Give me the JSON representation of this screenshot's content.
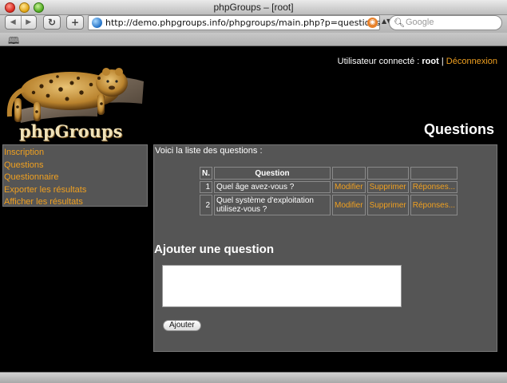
{
  "window": {
    "title": "phpGroups – [root]"
  },
  "toolbar": {
    "back_icon": "◀",
    "forward_icon": "▶",
    "reload_icon": "↻",
    "add_icon": "+",
    "url": "http://demo.phpgroups.info/phpgroups/main.php?p=questions",
    "search_placeholder": "Google"
  },
  "header": {
    "logo_text": "phpGroups",
    "user_label": "Utilisateur connecté :",
    "username": "root",
    "separator": "|",
    "logout_label": "Déconnexion",
    "page_title": "Questions"
  },
  "sidebar": {
    "items": [
      {
        "label": "Inscription"
      },
      {
        "label": "Questions"
      },
      {
        "label": "Questionnaire"
      },
      {
        "label": "Exporter les résultats"
      },
      {
        "label": "Afficher les résultats"
      }
    ]
  },
  "main": {
    "intro": "Voici la liste des questions :",
    "table": {
      "headers": [
        "N.",
        "Question",
        "",
        "",
        ""
      ],
      "rows": [
        {
          "num": "1",
          "question": "Quel âge avez-vous ?",
          "edit": "Modifier",
          "delete": "Supprimer",
          "answers": "Réponses..."
        },
        {
          "num": "2",
          "question": "Quel système d'exploitation utilisez-vous ?",
          "edit": "Modifier",
          "delete": "Supprimer",
          "answers": "Réponses..."
        }
      ]
    },
    "add": {
      "title": "Ajouter une question",
      "textarea_value": "",
      "button_label": "Ajouter"
    }
  },
  "colors": {
    "link": "#f0a020",
    "panel": "#555555",
    "background": "#000000"
  }
}
